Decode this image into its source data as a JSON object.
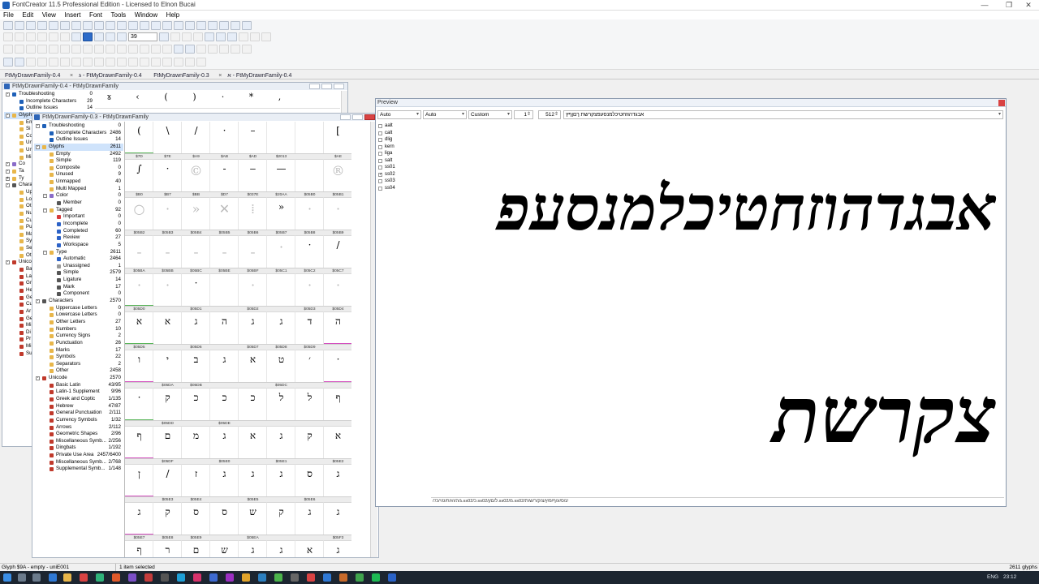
{
  "window": {
    "title": "FontCreator 11.5 Professional Edition - Licensed to Elnon Bucai",
    "min": "—",
    "max": "❐",
    "close": "✕"
  },
  "menu": [
    "File",
    "Edit",
    "View",
    "Insert",
    "Font",
    "Tools",
    "Window",
    "Help"
  ],
  "toolbar": {
    "zoom_value": "39"
  },
  "tabs": [
    {
      "label": "FtMyDrawnFamily-0.4"
    },
    {
      "label": "ג - FtMyDrawnFamily-0.4"
    },
    {
      "label": "FtMyDrawnFamily-0.3"
    },
    {
      "label": "א - FtMyDrawnFamily-0.4"
    }
  ],
  "tab_close": "×",
  "back_window": {
    "title": "FtMyDrawnFamily-0.4 - FtMyDrawnFamily"
  },
  "front_window": {
    "title": "FtMyDrawnFamily-0.3 - FtMyDrawnFamily"
  },
  "back_tree": [
    {
      "label": "Troubleshooting",
      "count": "0",
      "indent": 0,
      "icon": "#1e60b8",
      "exp": "-"
    },
    {
      "label": "Incomplete Characters",
      "count": "29",
      "indent": 1,
      "icon": "#1e60b8"
    },
    {
      "label": "Outline Issues",
      "count": "14",
      "indent": 1,
      "icon": "#1e60b8"
    },
    {
      "label": "Glyphs",
      "count": "",
      "indent": 0,
      "icon": "#e8b64a",
      "exp": "-",
      "sel": true
    },
    {
      "label": "Em",
      "count": "",
      "indent": 1,
      "icon": "#e8b64a"
    },
    {
      "label": "Si",
      "count": "",
      "indent": 1,
      "icon": "#e8b64a"
    },
    {
      "label": "Co",
      "count": "",
      "indent": 1,
      "icon": "#e8b64a"
    },
    {
      "label": "Un",
      "count": "",
      "indent": 1,
      "icon": "#e8b64a"
    },
    {
      "label": "Un",
      "count": "",
      "indent": 1,
      "icon": "#e8b64a"
    },
    {
      "label": "Mi",
      "count": "",
      "indent": 1,
      "icon": "#e8b64a"
    },
    {
      "label": "Co",
      "count": "",
      "indent": 0,
      "icon": "#8a6cc9",
      "exp": "-"
    },
    {
      "label": "Ta",
      "count": "",
      "indent": 0,
      "icon": "#e8b64a",
      "exp": "-"
    },
    {
      "label": "Ty",
      "count": "",
      "indent": 0,
      "icon": "#e8b64a",
      "exp": "+"
    },
    {
      "label": "Chara",
      "count": "",
      "indent": 0,
      "icon": "#555",
      "exp": "-"
    },
    {
      "label": "Up",
      "count": "",
      "indent": 1,
      "icon": "#e8b64a"
    },
    {
      "label": "Lo",
      "count": "",
      "indent": 1,
      "icon": "#e8b64a"
    },
    {
      "label": "Ot",
      "count": "",
      "indent": 1,
      "icon": "#e8b64a"
    },
    {
      "label": "Nu",
      "count": "",
      "indent": 1,
      "icon": "#e8b64a"
    },
    {
      "label": "Cu",
      "count": "",
      "indent": 1,
      "icon": "#e8b64a"
    },
    {
      "label": "Pu",
      "count": "",
      "indent": 1,
      "icon": "#e8b64a"
    },
    {
      "label": "Ma",
      "count": "",
      "indent": 1,
      "icon": "#e8b64a"
    },
    {
      "label": "Sy",
      "count": "",
      "indent": 1,
      "icon": "#e8b64a"
    },
    {
      "label": "Se",
      "count": "",
      "indent": 1,
      "icon": "#e8b64a"
    },
    {
      "label": "Ot",
      "count": "",
      "indent": 1,
      "icon": "#e8b64a"
    },
    {
      "label": "Unico",
      "count": "",
      "indent": 0,
      "icon": "#c0392b",
      "exp": "-"
    },
    {
      "label": "Ba",
      "count": "",
      "indent": 1,
      "icon": "#c0392b"
    },
    {
      "label": "La",
      "count": "",
      "indent": 1,
      "icon": "#c0392b"
    },
    {
      "label": "Gr",
      "count": "",
      "indent": 1,
      "icon": "#c0392b"
    },
    {
      "label": "He",
      "count": "",
      "indent": 1,
      "icon": "#c0392b"
    },
    {
      "label": "Ge",
      "count": "",
      "indent": 1,
      "icon": "#c0392b"
    },
    {
      "label": "Cu",
      "count": "",
      "indent": 1,
      "icon": "#c0392b"
    },
    {
      "label": "Ar",
      "count": "",
      "indent": 1,
      "icon": "#c0392b"
    },
    {
      "label": "Ge",
      "count": "",
      "indent": 1,
      "icon": "#c0392b"
    },
    {
      "label": "Mi",
      "count": "",
      "indent": 1,
      "icon": "#c0392b"
    },
    {
      "label": "Di",
      "count": "",
      "indent": 1,
      "icon": "#c0392b"
    },
    {
      "label": "Pr",
      "count": "",
      "indent": 1,
      "icon": "#c0392b"
    },
    {
      "label": "Mi",
      "count": "",
      "indent": 1,
      "icon": "#c0392b"
    },
    {
      "label": "Su",
      "count": "",
      "indent": 1,
      "icon": "#c0392b"
    }
  ],
  "front_tree": [
    {
      "label": "Troubleshooting",
      "count": "0",
      "indent": 0,
      "icon": "#1e60b8",
      "exp": "-"
    },
    {
      "label": "Incomplete Characters",
      "count": "2486",
      "indent": 1,
      "icon": "#1e60b8"
    },
    {
      "label": "Outline Issues",
      "count": "14",
      "indent": 1,
      "icon": "#1e60b8"
    },
    {
      "label": "Glyphs",
      "count": "2611",
      "indent": 0,
      "icon": "#e8b64a",
      "exp": "-",
      "sel": true
    },
    {
      "label": "Empty",
      "count": "2492",
      "indent": 1,
      "icon": "#e8b64a"
    },
    {
      "label": "Simple",
      "count": "119",
      "indent": 1,
      "icon": "#e8b64a"
    },
    {
      "label": "Composite",
      "count": "0",
      "indent": 1,
      "icon": "#e8b64a"
    },
    {
      "label": "Unused",
      "count": "9",
      "indent": 1,
      "icon": "#e8b64a"
    },
    {
      "label": "Unmapped",
      "count": "40",
      "indent": 1,
      "icon": "#e8b64a"
    },
    {
      "label": "Multi Mapped",
      "count": "1",
      "indent": 1,
      "icon": "#e8b64a"
    },
    {
      "label": "Color",
      "count": "0",
      "indent": 1,
      "icon": "#8a6cc9",
      "exp": "-"
    },
    {
      "label": "Member",
      "count": "0",
      "indent": 2,
      "icon": "#555"
    },
    {
      "label": "Tagged",
      "count": "92",
      "indent": 1,
      "icon": "#e8b64a",
      "exp": "-"
    },
    {
      "label": "Important",
      "count": "0",
      "indent": 2,
      "icon": "#d63b3b"
    },
    {
      "label": "Incomplete",
      "count": "0",
      "indent": 2,
      "icon": "#2c62c7"
    },
    {
      "label": "Completed",
      "count": "60",
      "indent": 2,
      "icon": "#2c62c7"
    },
    {
      "label": "Review",
      "count": "27",
      "indent": 2,
      "icon": "#2c62c7"
    },
    {
      "label": "Workspace",
      "count": "5",
      "indent": 2,
      "icon": "#2c62c7"
    },
    {
      "label": "Type",
      "count": "2611",
      "indent": 1,
      "icon": "#e8b64a",
      "exp": "-"
    },
    {
      "label": "Automatic",
      "count": "2464",
      "indent": 2,
      "icon": "#2c62c7"
    },
    {
      "label": "Unassigned",
      "count": "1",
      "indent": 2,
      "icon": "#999"
    },
    {
      "label": "Simple",
      "count": "2579",
      "indent": 2,
      "icon": "#555"
    },
    {
      "label": "Ligature",
      "count": "14",
      "indent": 2,
      "icon": "#555"
    },
    {
      "label": "Mark",
      "count": "17",
      "indent": 2,
      "icon": "#555"
    },
    {
      "label": "Component",
      "count": "0",
      "indent": 2,
      "icon": "#555"
    },
    {
      "label": "Characters",
      "count": "2570",
      "indent": 0,
      "icon": "#555",
      "exp": "-"
    },
    {
      "label": "Uppercase Letters",
      "count": "0",
      "indent": 1,
      "icon": "#e8b64a"
    },
    {
      "label": "Lowercase Letters",
      "count": "0",
      "indent": 1,
      "icon": "#e8b64a"
    },
    {
      "label": "Other Letters",
      "count": "27",
      "indent": 1,
      "icon": "#e8b64a"
    },
    {
      "label": "Numbers",
      "count": "10",
      "indent": 1,
      "icon": "#e8b64a"
    },
    {
      "label": "Currency Signs",
      "count": "2",
      "indent": 1,
      "icon": "#e8b64a"
    },
    {
      "label": "Punctuation",
      "count": "26",
      "indent": 1,
      "icon": "#e8b64a"
    },
    {
      "label": "Marks",
      "count": "17",
      "indent": 1,
      "icon": "#e8b64a"
    },
    {
      "label": "Symbols",
      "count": "22",
      "indent": 1,
      "icon": "#e8b64a"
    },
    {
      "label": "Separators",
      "count": "2",
      "indent": 1,
      "icon": "#e8b64a"
    },
    {
      "label": "Other",
      "count": "2458",
      "indent": 1,
      "icon": "#e8b64a"
    },
    {
      "label": "Unicode",
      "count": "2570",
      "indent": 0,
      "icon": "#c0392b",
      "exp": "-"
    },
    {
      "label": "Basic Latin",
      "count": "43/95",
      "indent": 1,
      "icon": "#c0392b"
    },
    {
      "label": "Latin-1 Supplement",
      "count": "9/96",
      "indent": 1,
      "icon": "#c0392b"
    },
    {
      "label": "Greek and Coptic",
      "count": "1/135",
      "indent": 1,
      "icon": "#c0392b"
    },
    {
      "label": "Hebrew",
      "count": "47/87",
      "indent": 1,
      "icon": "#c0392b"
    },
    {
      "label": "General Punctuation",
      "count": "2/111",
      "indent": 1,
      "icon": "#c0392b"
    },
    {
      "label": "Currency Symbols",
      "count": "1/32",
      "indent": 1,
      "icon": "#c0392b"
    },
    {
      "label": "Arrows",
      "count": "2/112",
      "indent": 1,
      "icon": "#c0392b"
    },
    {
      "label": "Geometric Shapes",
      "count": "2/96",
      "indent": 1,
      "icon": "#c0392b"
    },
    {
      "label": "Miscellaneous Symb...",
      "count": "2/256",
      "indent": 1,
      "icon": "#c0392b"
    },
    {
      "label": "Dingbats",
      "count": "1/192",
      "indent": 1,
      "icon": "#c0392b"
    },
    {
      "label": "Private Use Area",
      "count": "2457/6400",
      "indent": 1,
      "icon": "#c0392b"
    },
    {
      "label": "Miscellaneous Symb...",
      "count": "2/768",
      "indent": 1,
      "icon": "#c0392b"
    },
    {
      "label": "Supplemental Symb...",
      "count": "1/148",
      "indent": 1,
      "icon": "#c0392b"
    }
  ],
  "back_strip": [
    "ɤ",
    "‹",
    "(",
    ")",
    "·",
    "*",
    ","
  ],
  "glyph_grid": [
    {
      "g": "(",
      "c": "$7D",
      "bar": "#5ab55a"
    },
    {
      "g": "\\",
      "c": "$7E"
    },
    {
      "g": "/",
      "c": "$A9"
    },
    {
      "g": "·",
      "c": "$AB"
    },
    {
      "g": "–",
      "c": "$AD"
    },
    {
      "g": "",
      "c": "$2013"
    },
    {
      "g": "",
      "c": ""
    },
    {
      "g": "[",
      "c": "$AE"
    },
    {
      "g": "∫",
      "c": "$B0"
    },
    {
      "g": "·",
      "c": "$B7"
    },
    {
      "g": "©",
      "c": "$BB",
      "light": true
    },
    {
      "g": "-",
      "c": "$D7"
    },
    {
      "g": "‒",
      "c": "$037E"
    },
    {
      "g": "—",
      "c": "$20AA"
    },
    {
      "g": "",
      "c": "$05B0"
    },
    {
      "g": "®",
      "c": "$05B1",
      "light": true
    },
    {
      "g": "○",
      "c": "$05B2",
      "light": true
    },
    {
      "g": "·",
      "c": "$05B3",
      "light": true
    },
    {
      "g": "»",
      "c": "$05B4",
      "light": true
    },
    {
      "g": "✕",
      "c": "$05B5",
      "light": true
    },
    {
      "g": "⁞",
      "c": "$05B6",
      "light": true
    },
    {
      "g": "»",
      "c": "$05B7"
    },
    {
      "g": "·",
      "c": "$05B8",
      "light": true
    },
    {
      "g": "·",
      "c": "$05B9",
      "light": true
    },
    {
      "g": "ˍ",
      "c": "$05BA",
      "light": true
    },
    {
      "g": "ˍ",
      "c": "$05BB",
      "light": true
    },
    {
      "g": "ˍ",
      "c": "$05BC",
      "light": true
    },
    {
      "g": "ˍ",
      "c": "$05BE",
      "light": true
    },
    {
      "g": "ˍ",
      "c": "$05BF",
      "light": true
    },
    {
      "g": "·",
      "c": "$05C1",
      "light": true
    },
    {
      "g": "·",
      "c": "$05C2"
    },
    {
      "g": "/",
      "c": "$05C7"
    },
    {
      "g": "·",
      "c": "$05D0",
      "light": true,
      "bar": "#5ab55a"
    },
    {
      "g": "·",
      "c": "",
      "light": true
    },
    {
      "g": "·",
      "c": "$05D1"
    },
    {
      "g": "",
      "c": ""
    },
    {
      "g": "·",
      "c": "$05D2",
      "light": true
    },
    {
      "g": "",
      "c": ""
    },
    {
      "g": "·",
      "c": "$05D3",
      "light": true
    },
    {
      "g": "·",
      "c": "$05D4",
      "light": true
    },
    {
      "g": "א",
      "c": "$05D5",
      "bar": "#5ab55a"
    },
    {
      "g": "א",
      "c": ""
    },
    {
      "g": "ג",
      "c": "$05D6"
    },
    {
      "g": "ה",
      "c": ""
    },
    {
      "g": "ג",
      "c": "$05D7"
    },
    {
      "g": "ג",
      "c": "$05D8"
    },
    {
      "g": "ד",
      "c": "$05D9"
    },
    {
      "g": "ה",
      "c": "",
      "bar": "#d44fbf"
    },
    {
      "g": "ו",
      "c": "",
      "bar": "#d44fbf"
    },
    {
      "g": "י",
      "c": "$05DA"
    },
    {
      "g": "ב",
      "c": "$05DB"
    },
    {
      "g": "ג",
      "c": ""
    },
    {
      "g": "א",
      "c": ""
    },
    {
      "g": "ט",
      "c": "$05DC"
    },
    {
      "g": "׳",
      "c": ""
    },
    {
      "g": "·",
      "c": "",
      "bar": "#d44fbf"
    },
    {
      "g": "·",
      "c": "",
      "bar": "#5ab55a"
    },
    {
      "g": "ק",
      "c": "$05DD"
    },
    {
      "g": "כ",
      "c": ""
    },
    {
      "g": "כ",
      "c": "$05DE"
    },
    {
      "g": "כ",
      "c": ""
    },
    {
      "g": "ל",
      "c": ""
    },
    {
      "g": "ל",
      "c": ""
    },
    {
      "g": "ף",
      "c": ""
    },
    {
      "g": "ף",
      "c": "",
      "bar": "#d44fbf"
    },
    {
      "g": "ם",
      "c": "$05DF"
    },
    {
      "g": "מ",
      "c": ""
    },
    {
      "g": "ג",
      "c": "$05E0"
    },
    {
      "g": "א",
      "c": ""
    },
    {
      "g": "ג",
      "c": "$05E1"
    },
    {
      "g": "ק",
      "c": ""
    },
    {
      "g": "א",
      "c": "$05E2"
    },
    {
      "g": "ן",
      "c": "",
      "bar": "#d44fbf"
    },
    {
      "g": "/",
      "c": "$05E3"
    },
    {
      "g": "ז",
      "c": "$05E4"
    },
    {
      "g": "ג",
      "c": ""
    },
    {
      "g": "ג",
      "c": "$05E5"
    },
    {
      "g": "ג",
      "c": ""
    },
    {
      "g": "ס",
      "c": "$05E6"
    },
    {
      "g": "ג",
      "c": ""
    },
    {
      "g": "ג",
      "c": "$05E7",
      "bar": "#d44fbf"
    },
    {
      "g": "ק",
      "c": "$05E8"
    },
    {
      "g": "ס",
      "c": "$05E9"
    },
    {
      "g": "ס",
      "c": ""
    },
    {
      "g": "ש",
      "c": "$05EA"
    },
    {
      "g": "ק",
      "c": ""
    },
    {
      "g": "ג",
      "c": ""
    },
    {
      "g": "ג",
      "c": "$05F3"
    },
    {
      "g": "ף",
      "c": "",
      "bar": "#d44fbf"
    },
    {
      "g": "ר",
      "c": ""
    },
    {
      "g": "ם",
      "c": ""
    },
    {
      "g": "ש",
      "c": ""
    },
    {
      "g": "ג",
      "c": ""
    },
    {
      "g": "ג",
      "c": ""
    },
    {
      "g": "א",
      "c": ""
    },
    {
      "g": "ג",
      "c": ""
    }
  ],
  "preview": {
    "title": "Preview",
    "script": "Auto",
    "language": "Auto",
    "mode": "Custom",
    "spin1": "1",
    "size": "512",
    "text": "אבגדהוזחטיכלמנסעפצקרשת ךםןףץ",
    "features": [
      {
        "name": "aalt",
        "checked": false
      },
      {
        "name": "calt",
        "checked": false
      },
      {
        "name": "dlig",
        "checked": false
      },
      {
        "name": "kern",
        "checked": false
      },
      {
        "name": "liga",
        "checked": false
      },
      {
        "name": "salt",
        "checked": false
      },
      {
        "name": "ss01",
        "checked": false
      },
      {
        "name": "ss02",
        "checked": true
      },
      {
        "name": "ss03",
        "checked": false
      },
      {
        "name": "ss04",
        "checked": false
      }
    ],
    "line1": "אבגדהוזחטיכלמנסעפ",
    "line2": "צקרשת",
    "glyph_strip": "/'/ג/ה/ו/ז/ח/ט/י/כ.ss02/כ.ss02/ל/ם/ן.ss02/מ.ss02/נ/ס/ע/ף/פ/ץ/צ/ק/ר/ש/ת/"
  },
  "status": {
    "left": "Glyph $9A - empty - uniE001",
    "mid": "1 item selected",
    "right": "2611 glyphs"
  },
  "taskbar": {
    "lang": "ENG",
    "time": "23:12"
  }
}
